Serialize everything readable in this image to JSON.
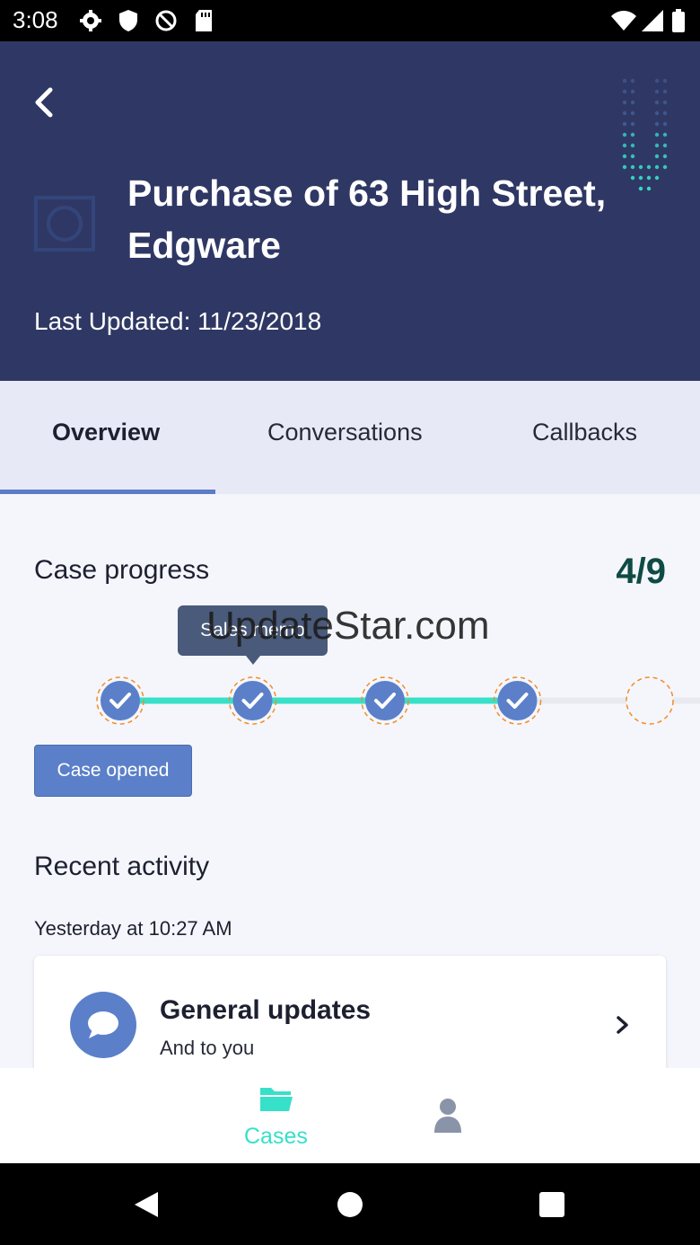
{
  "status_bar": {
    "time": "3:08"
  },
  "header": {
    "title": "Purchase of 63 High Street, Edgware",
    "last_updated": "Last Updated: 11/23/2018"
  },
  "tabs": [
    {
      "label": "Overview",
      "active": true
    },
    {
      "label": "Conversations",
      "active": false
    },
    {
      "label": "Callbacks",
      "active": false
    }
  ],
  "case_progress": {
    "title": "Case progress",
    "count": "4/9",
    "completed_steps": 4,
    "total_steps": 9,
    "tooltip": "Sales memo",
    "current_step_label": "Case opened"
  },
  "watermark": "UpdateStar.com",
  "recent_activity": {
    "title": "Recent activity",
    "date": "Yesterday at 10:27 AM",
    "items": [
      {
        "title": "General updates",
        "subtitle": "And to you"
      }
    ]
  },
  "bottom_nav": {
    "cases_label": "Cases"
  },
  "colors": {
    "header_bg": "#2f3864",
    "accent_teal": "#37e0c9",
    "step_blue": "#5b80c9",
    "step_ring": "#f28c28",
    "count_green": "#0f4b45"
  }
}
